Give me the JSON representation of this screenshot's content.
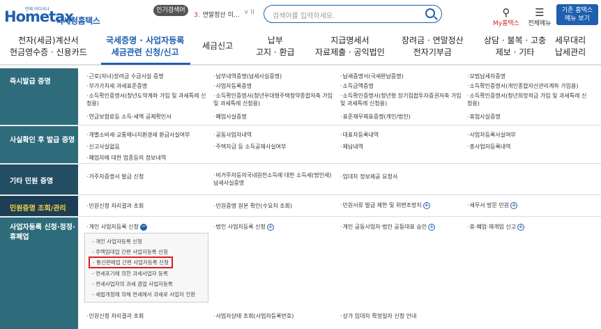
{
  "header": {
    "logo_text": "Hometax",
    "logo_sub": "국세청홈택스",
    "logo_tiny": "언제 어디서나",
    "popular_badge": "인기검색어",
    "popular_rank": "3.",
    "popular_term": "연말정산 미...",
    "popular_ctl": "∨ II",
    "search_placeholder": "검색어를 입력하세요.",
    "my_label": "My홈택스",
    "allmenu_label": "전체메뉴",
    "classic_label_1": "기존 홈택스",
    "classic_label_2": "메뉴 보기"
  },
  "gnb": [
    {
      "l1": "전자(세금)계산서",
      "l2": "현금영수증 · 신용카드"
    },
    {
      "l1": "국세증명 · 사업자등록",
      "l2": "세금관련 신청/신고"
    },
    {
      "l1": "세금신고",
      "l2": ""
    },
    {
      "l1": "납부",
      "l2": "고지 · 환급"
    },
    {
      "l1": "지급명세서",
      "l2": "자료제출 · 공익법인"
    },
    {
      "l1": "장려금 · 연말정산",
      "l2": "전자기부금"
    },
    {
      "l1": "상담 · 불복 · 고충",
      "l2": "제보 · 기타"
    },
    {
      "l1": "세무대리",
      "l2": "납세관리"
    }
  ],
  "categories": {
    "instant": "즉시발급 증명",
    "after": "사실확인 후 발급 증명",
    "other": "기타 민원 증명",
    "inquiry": "민원증명 조회/관리",
    "bizreg_1": "사업자등록 신청·정정·",
    "bizreg_2": "휴폐업"
  },
  "instant_items": [
    "근로(자녀)장려금 수급사실 증명",
    "부가가치세 과세표준증명",
    "소득확인증명서(청년도약계좌 가입 및 과세특례 신청용)",
    "연금보험료등 소득·세액 공제확인서",
    "납부내역증명(납세사실증명)",
    "사업자등록증명",
    "소득확인증명서(청년우대형주택청약종합저축 가입 및 과세특례 신청용)",
    "폐업사실증명",
    "납세증명서(국세완납증명)",
    "소득금액증명",
    "소득확인증명서(청년형 장기집합투자증권저축 가입 및 과세특례 신청용)",
    "표준재무제표증명(개인/법인)",
    "모범납세자증명",
    "소득확인증명서(개인종합자산관리계좌 가입용)",
    "소득확인증명서(청년희망적금 가입 및 과세특례 신청용)",
    "휴업사실증명"
  ],
  "after_items": [
    "개별소비세·교통에너지환경세 환급사실여부",
    "신고사실없음",
    "폐업자에 대한 업종등의 정보내역",
    "공동사업자내역",
    "주택자금 등 소득공제사실여부",
    "대표자등록내역",
    "체납내역",
    "사업자등록사실여부",
    "총사업자등록내역"
  ],
  "other_items": [
    "거주자증명서 발급 신청",
    "비거주자등의국내원천소득에 대한 소득세(법인세) 납세사실증명",
    "임대차 정보제공 요청서"
  ],
  "inquiry_items": [
    "민원신청 처리결과 조회",
    "민원증명 원본 확인(수요처 조회)",
    "민원서류 발급 제한 및 위변조방지",
    "세무서 방문 민원"
  ],
  "bizreg_items": [
    "개인 사업자등록 신청",
    "법인 사업자등록 신청",
    "개인 공동사업자·법인 공동대표 승인",
    "휴·폐업·재개업 신고"
  ],
  "submenu": [
    "- 개인 사업자등록 신청",
    "- 주택임대업 간편 사업자등록 신청",
    "- 통신판매업 간편 사업자등록 신청",
    "- 면세포기에 의한 과세사업자 등록",
    "- 면세사업자의 과세 겸업 사업자등록",
    "- 세법개정에 의해 면세에서 과세로 사업자 전환"
  ],
  "bottom_items": [
    "민원신청 처리결과 조회",
    "사업자상태 조회(사업자등록번호)",
    "상가 임대차 확정일자 신청 안내"
  ]
}
